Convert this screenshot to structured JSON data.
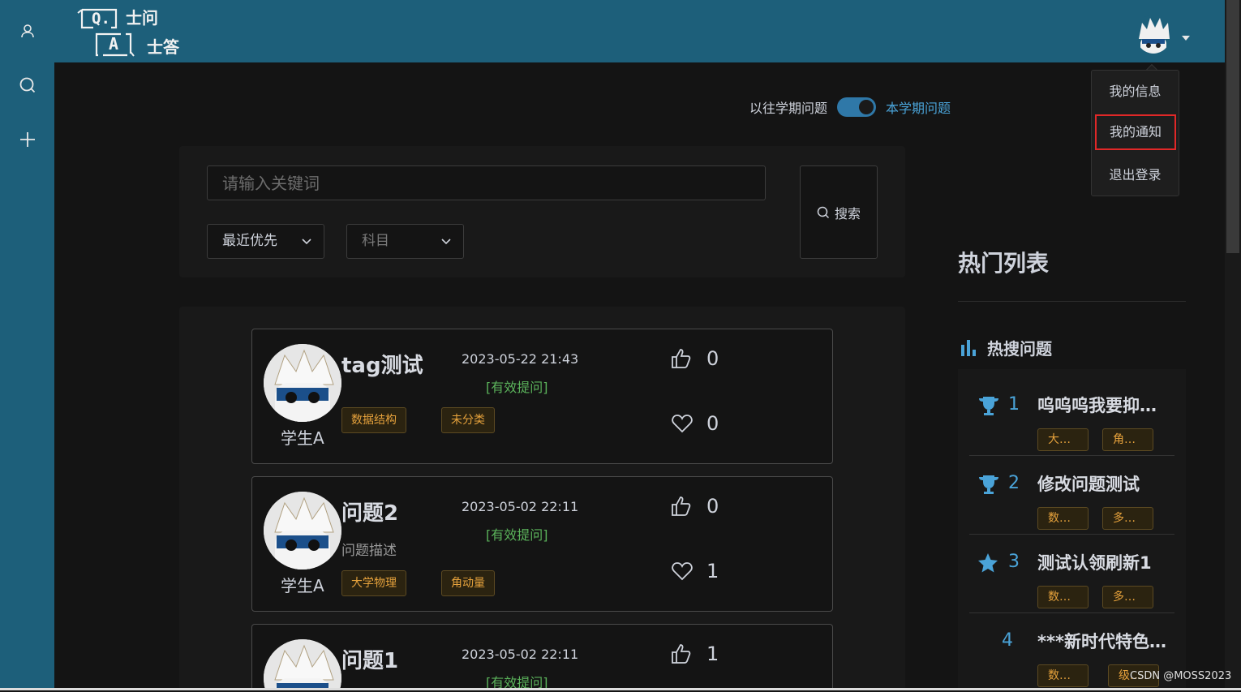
{
  "logo": {
    "q": "Q.",
    "a": "A",
    "line1": "士问",
    "line2": "士答"
  },
  "dropdown": {
    "items": [
      "我的信息",
      "我的通知",
      "退出登录"
    ]
  },
  "toggle": {
    "left_label": "以往学期问题",
    "right_label": "本学期问题",
    "on": true
  },
  "search": {
    "placeholder": "请输入关键词",
    "button_label": "搜索",
    "sort_select": "最近优先",
    "subject_select": "科目"
  },
  "questions": [
    {
      "title": "tag测试",
      "user": "学生A",
      "date": "2023-05-22 21:43",
      "status": "[有效提问]",
      "desc": "",
      "tags": [
        "数据结构",
        "未分类"
      ],
      "likes": "0",
      "favs": "0"
    },
    {
      "title": "问题2",
      "user": "学生A",
      "date": "2023-05-02 22:11",
      "status": "[有效提问]",
      "desc": "问题描述",
      "tags": [
        "大学物理",
        "角动量"
      ],
      "likes": "0",
      "favs": "1"
    },
    {
      "title": "问题1",
      "user": "学生A",
      "date": "2023-05-02 22:11",
      "status": "[有效提问]",
      "desc": "",
      "tags": [],
      "likes": "1",
      "favs": ""
    }
  ],
  "hot": {
    "title": "热门列表",
    "subtitle": "热搜问题",
    "items": [
      {
        "rank": "1",
        "name": "呜呜呜我要抑…",
        "icon": "trophy-icon",
        "tags": [
          "大…",
          "角…"
        ]
      },
      {
        "rank": "2",
        "name": "修改问题测试",
        "icon": "trophy-icon",
        "tags": [
          "数…",
          "多…"
        ]
      },
      {
        "rank": "3",
        "name": "测试认领刷新1",
        "icon": "star-icon",
        "tags": [
          "数…",
          "多…"
        ]
      },
      {
        "rank": "4",
        "name": "***新时代特色…",
        "icon": "",
        "tags": [
          "数…",
          "级…"
        ]
      }
    ]
  },
  "watermark": "CSDN @MOSS2023",
  "colors": {
    "accent": "#1d5f7a",
    "link": "#4aa3d8",
    "tag": "#e6a23c",
    "status": "#5bb35b",
    "highlight": "#e02828"
  }
}
